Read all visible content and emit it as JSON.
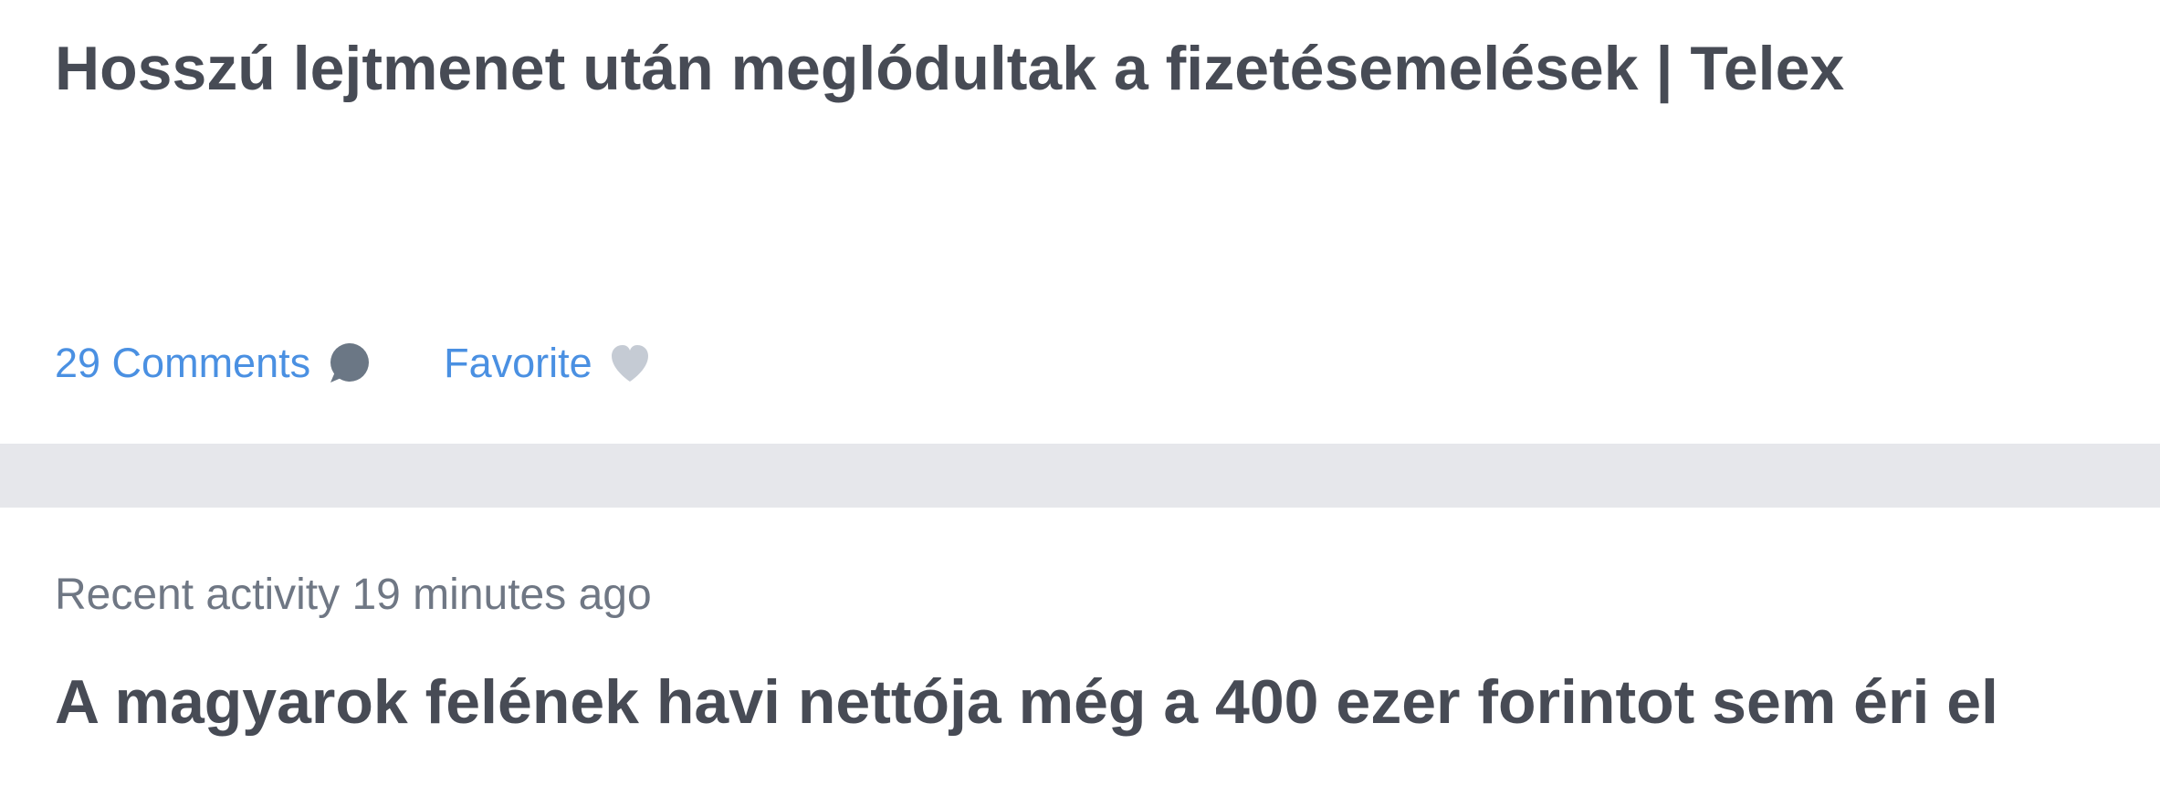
{
  "feed": {
    "item1": {
      "title": "Hosszú lejtmenet után meglódultak a fizetésemelések | Telex",
      "comments_label": "29 Comments",
      "favorite_label": "Favorite",
      "icons": {
        "comments": "speech-bubble-icon",
        "favorite": "heart-icon"
      }
    },
    "item2": {
      "activity": "Recent activity 19 minutes ago",
      "title": "A magyarok felének havi nettója még a 400 ezer forintot sem éri el"
    }
  },
  "colors": {
    "title": "#474b55",
    "link": "#4a90e2",
    "meta": "#6f7784",
    "separator": "#e6e7eb",
    "comment_icon": "#6b7785",
    "heart_icon": "#c5cbd4"
  }
}
